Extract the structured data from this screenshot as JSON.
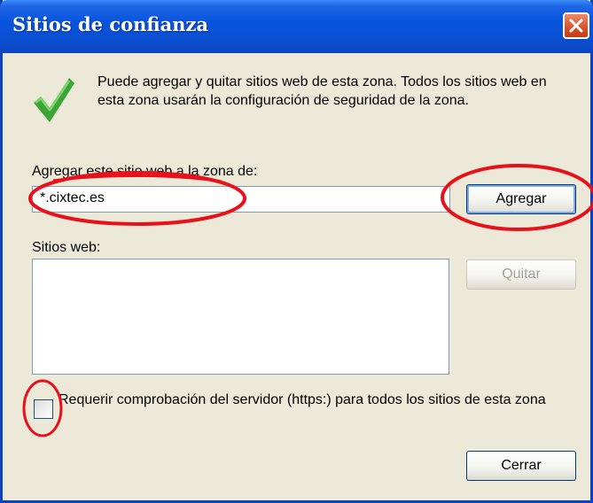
{
  "window": {
    "title": "Sitios de confianza"
  },
  "info": {
    "text": "Puede agregar y quitar sitios web de esta zona. Todos los sitios web en esta zona usarán la configuración de seguridad de la zona."
  },
  "add_site": {
    "label": "Agregar este sitio web a la zona de:",
    "value": "*.cixtec.es",
    "button_label": "Agregar"
  },
  "sites": {
    "label": "Sitios web:",
    "items": [],
    "remove_label": "Quitar"
  },
  "https_checkbox": {
    "label": "Requerir comprobación del servidor (https:) para todos los sitios de esta zona",
    "checked": false
  },
  "footer": {
    "close_label": "Cerrar"
  },
  "colors": {
    "titlebar": "#0855dd",
    "annotation_red": "#e8111a",
    "checkmark_green": "#3aa435"
  },
  "icons": [
    "checkmark-icon",
    "close-icon"
  ]
}
